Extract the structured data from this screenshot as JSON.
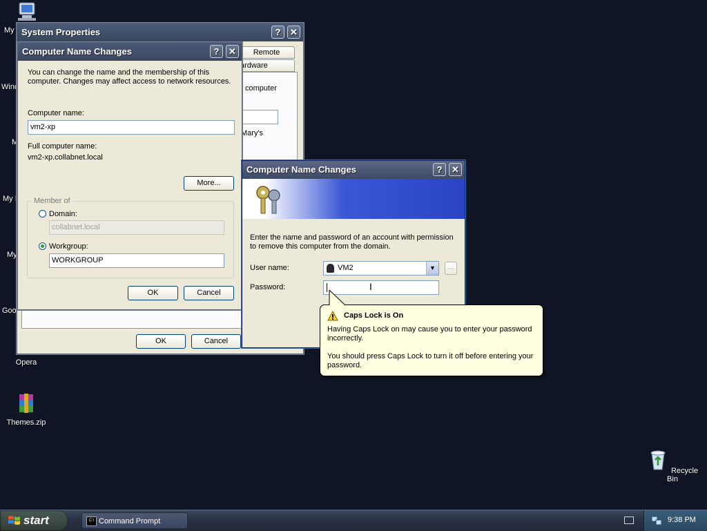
{
  "desktop": {
    "icons": [
      {
        "label": "My",
        "icon": "my-computer-icon"
      },
      {
        "label": "Wind",
        "icon": "windows-icon"
      },
      {
        "label": "M",
        "icon": "folder-icon"
      },
      {
        "label": "My I",
        "icon": "network-icon"
      },
      {
        "label": "My",
        "icon": "documents-icon"
      },
      {
        "label": "Goo",
        "icon": "google-icon"
      },
      {
        "label": "Opera",
        "icon": "opera-icon"
      },
      {
        "label": "Themes.zip",
        "icon": "winrar-archive-icon"
      },
      {
        "label": "Recycle Bin",
        "icon": "recycle-bin-icon"
      }
    ]
  },
  "system_properties": {
    "title": "System Properties",
    "tabs": [
      "Remote",
      "ardware"
    ],
    "partial_text_1": "computer",
    "partial_text_2": "Mary's",
    "ok_label": "OK",
    "cancel_label": "Cancel"
  },
  "name_changes_main": {
    "title": "Computer Name Changes",
    "intro": "You can change the name and the membership of this computer. Changes may affect access to network resources.",
    "computer_name_label": "Computer name:",
    "computer_name_value": "vm2-xp",
    "full_name_label": "Full computer name:",
    "full_name_value": "vm2-xp.collabnet.local",
    "more_label": "More...",
    "member_of_label": "Member of",
    "domain_label": "Domain:",
    "domain_value": "collabnet.local",
    "workgroup_label": "Workgroup:",
    "workgroup_value": "WORKGROUP",
    "ok_label": "OK",
    "cancel_label": "Cancel"
  },
  "credentials_dialog": {
    "title": "Computer Name Changes",
    "prompt": "Enter the name and password of an account with permission to remove this computer from the domain.",
    "username_label": "User name:",
    "username_value": "VM2",
    "browse_label": "...",
    "password_label": "Password:",
    "password_value": ""
  },
  "balloon": {
    "title": "Caps Lock is On",
    "line1": "Having Caps Lock on may cause you to enter your password incorrectly.",
    "line2": "You should press Caps Lock to turn it off before entering your password."
  },
  "taskbar": {
    "start_label": "start",
    "items": [
      {
        "label": "Command Prompt",
        "icon": "command-prompt-icon"
      }
    ],
    "clock": "9:38 PM"
  }
}
